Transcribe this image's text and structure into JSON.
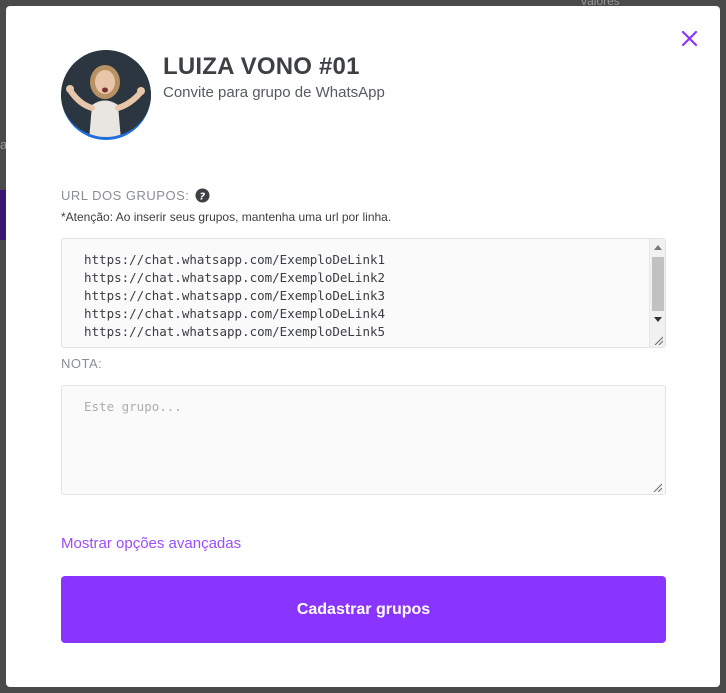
{
  "backdrop": {
    "hint_text": "Valores"
  },
  "modal": {
    "title": "LUIZA VONO #01",
    "subtitle": "Convite para grupo de WhatsApp",
    "close_icon": "close-icon",
    "accent_color": "#8a35ff"
  },
  "url_section": {
    "label": "URL DOS GRUPOS:",
    "help_icon": "question-circle-icon",
    "warning": "*Atenção: Ao inserir seus grupos, mantenha uma url por linha.",
    "lines": [
      "https://chat.whatsapp.com/ExemploDeLink1",
      "https://chat.whatsapp.com/ExemploDeLink2",
      "https://chat.whatsapp.com/ExemploDeLink3",
      "https://chat.whatsapp.com/ExemploDeLink4",
      "https://chat.whatsapp.com/ExemploDeLink5"
    ]
  },
  "nota_section": {
    "label": "NOTA:",
    "placeholder": "Este grupo...",
    "value": ""
  },
  "advanced_link": "Mostrar opções avançadas",
  "submit_label": "Cadastrar grupos"
}
